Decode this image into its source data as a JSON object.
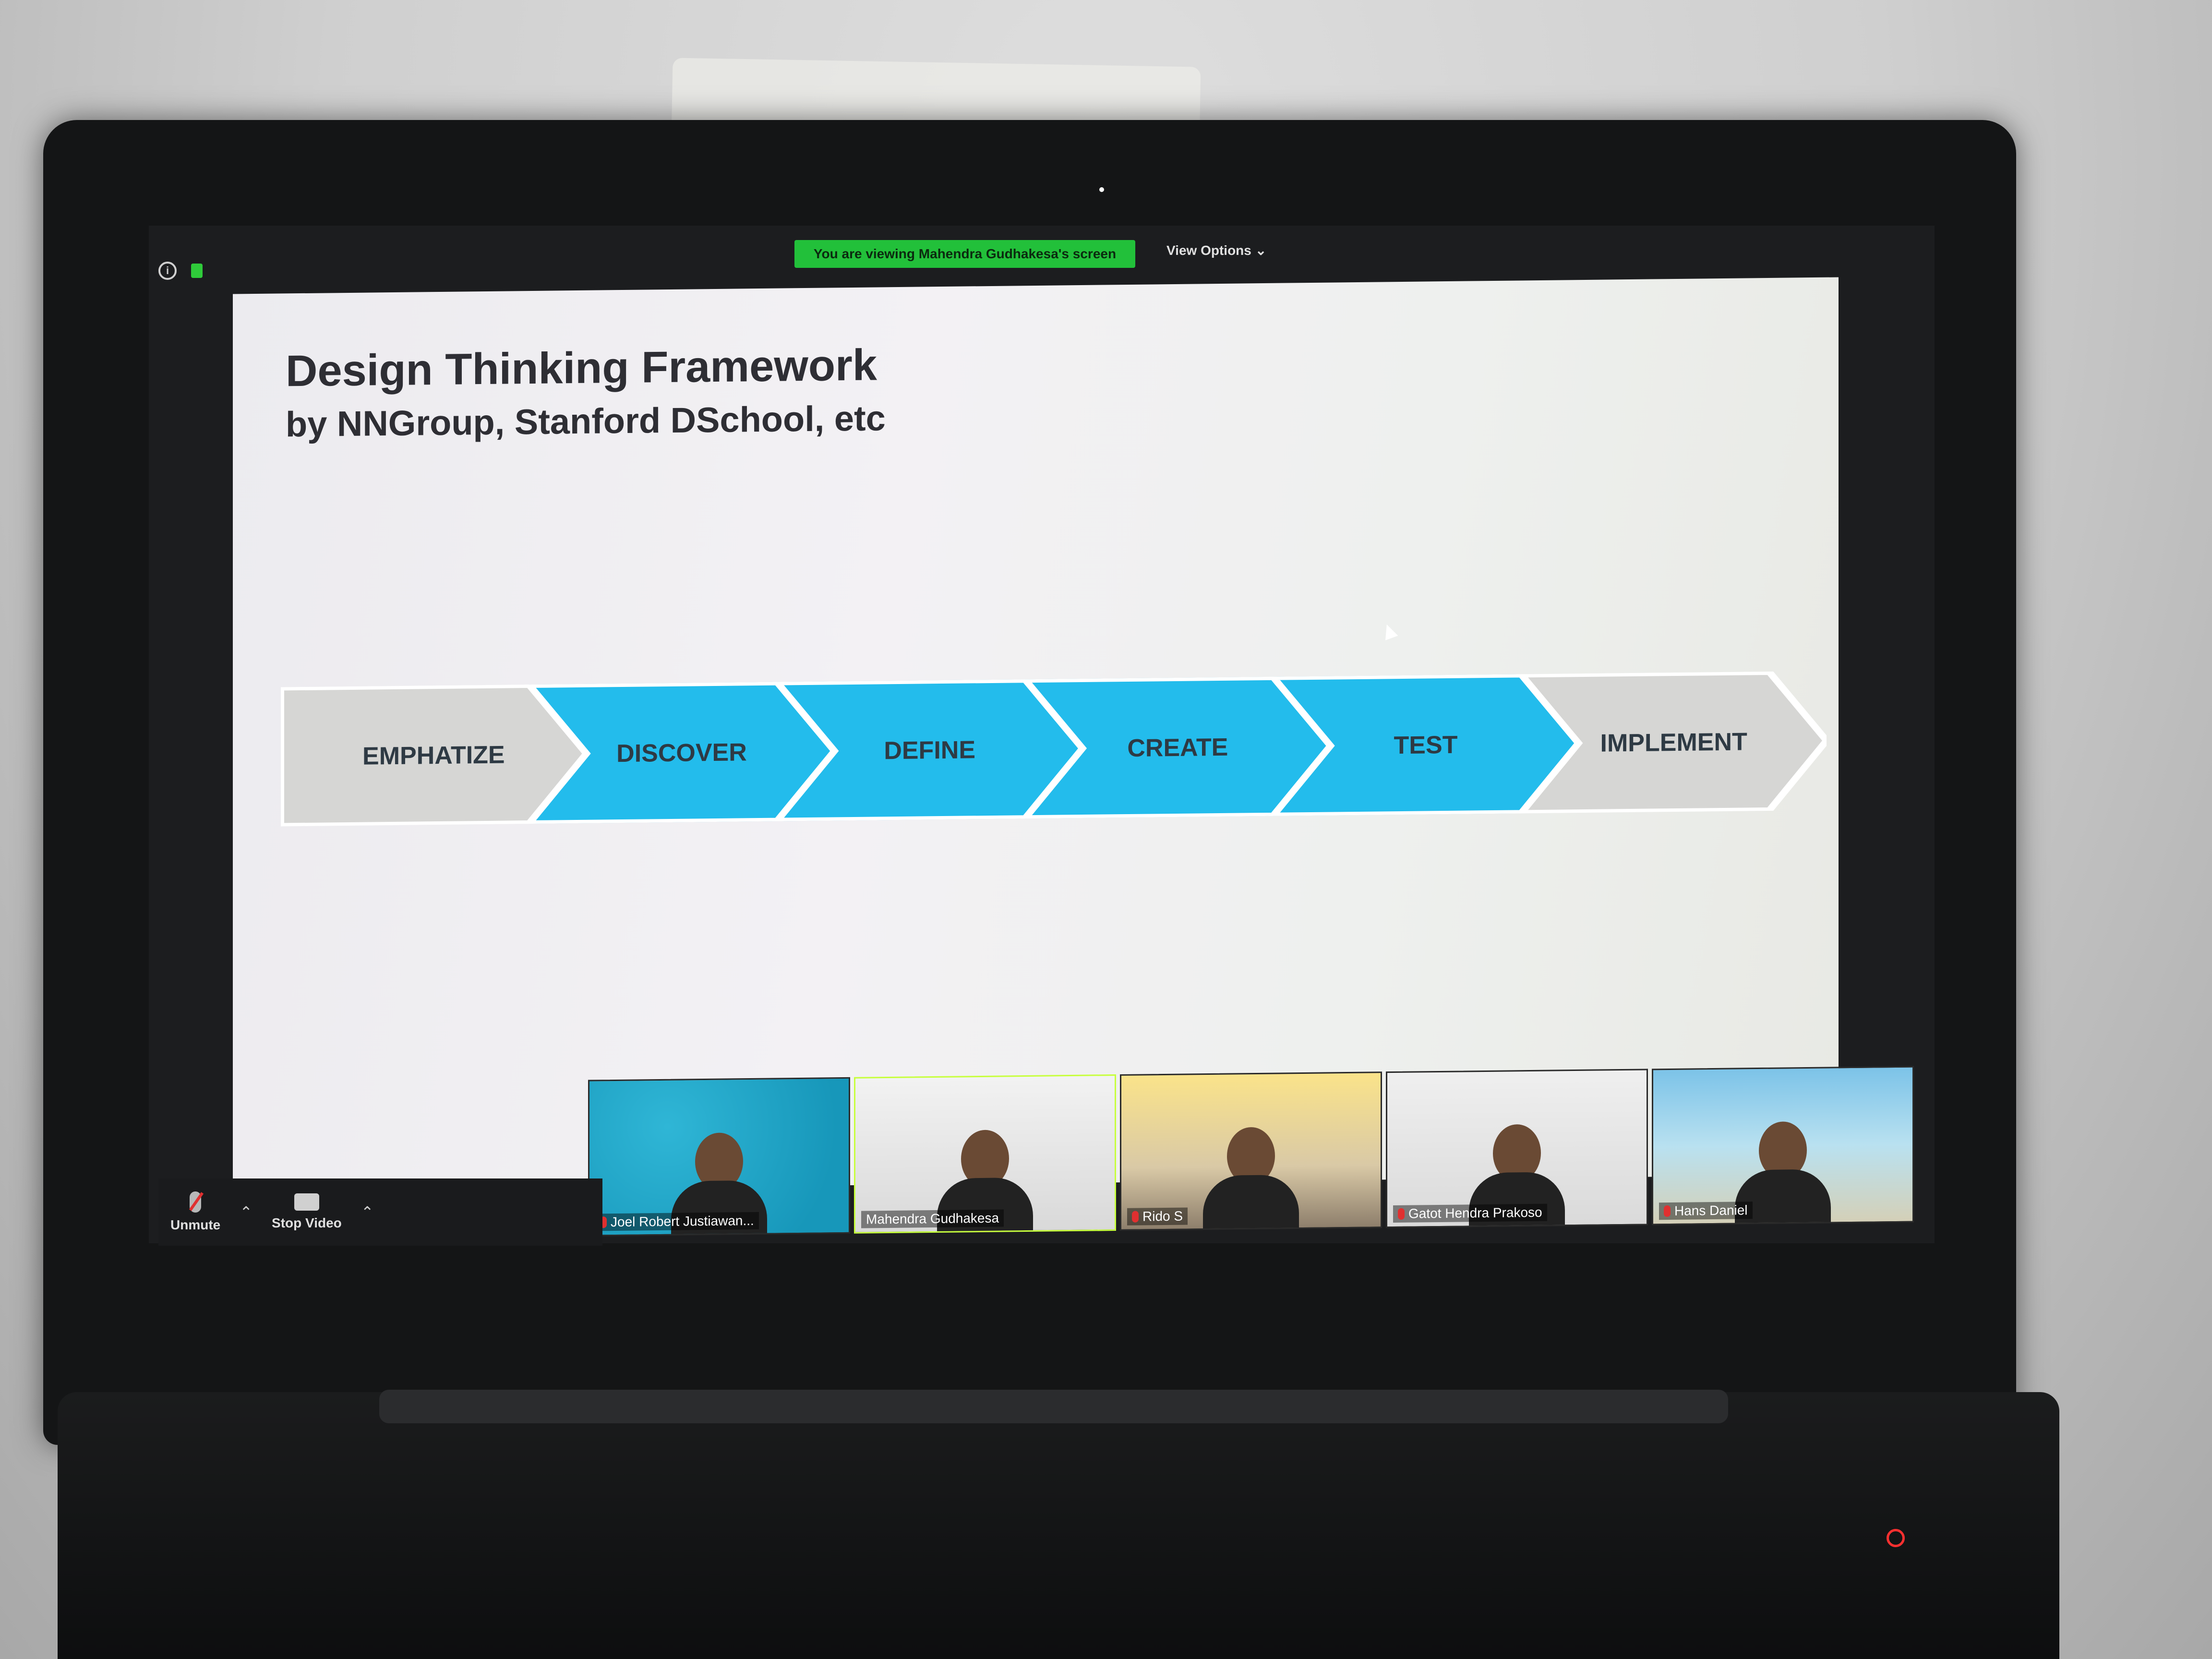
{
  "zoom": {
    "share_banner": "You are viewing Mahendra Gudhakesa's screen",
    "view_options": "View Options",
    "toolbar": {
      "unmute_label": "Unmute",
      "stop_video_label": "Stop Video"
    },
    "participants": [
      {
        "name": "Joel Robert Justiawan..."
      },
      {
        "name": "Mahendra Gudhakesa"
      },
      {
        "name": "Rido S"
      },
      {
        "name": "Gatot Hendra Prakoso"
      },
      {
        "name": "Hans Daniel"
      }
    ]
  },
  "slide": {
    "title": "Design Thinking Framework",
    "subtitle": "by NNGroup, Stanford DSchool, etc",
    "steps": [
      {
        "label": "EMPHATIZE",
        "highlighted": false
      },
      {
        "label": "DISCOVER",
        "highlighted": true
      },
      {
        "label": "DEFINE",
        "highlighted": true
      },
      {
        "label": "CREATE",
        "highlighted": true
      },
      {
        "label": "TEST",
        "highlighted": true
      },
      {
        "label": "IMPLEMENT",
        "highlighted": false
      }
    ],
    "colors": {
      "highlight": "#23bcec",
      "muted": "#d6d6d4",
      "text": "#2e3a44"
    }
  },
  "icons": {
    "info": "info-icon",
    "lock": "lock-icon",
    "mic": "mic-muted-icon",
    "camera": "video-camera-icon",
    "power": "power-icon"
  }
}
